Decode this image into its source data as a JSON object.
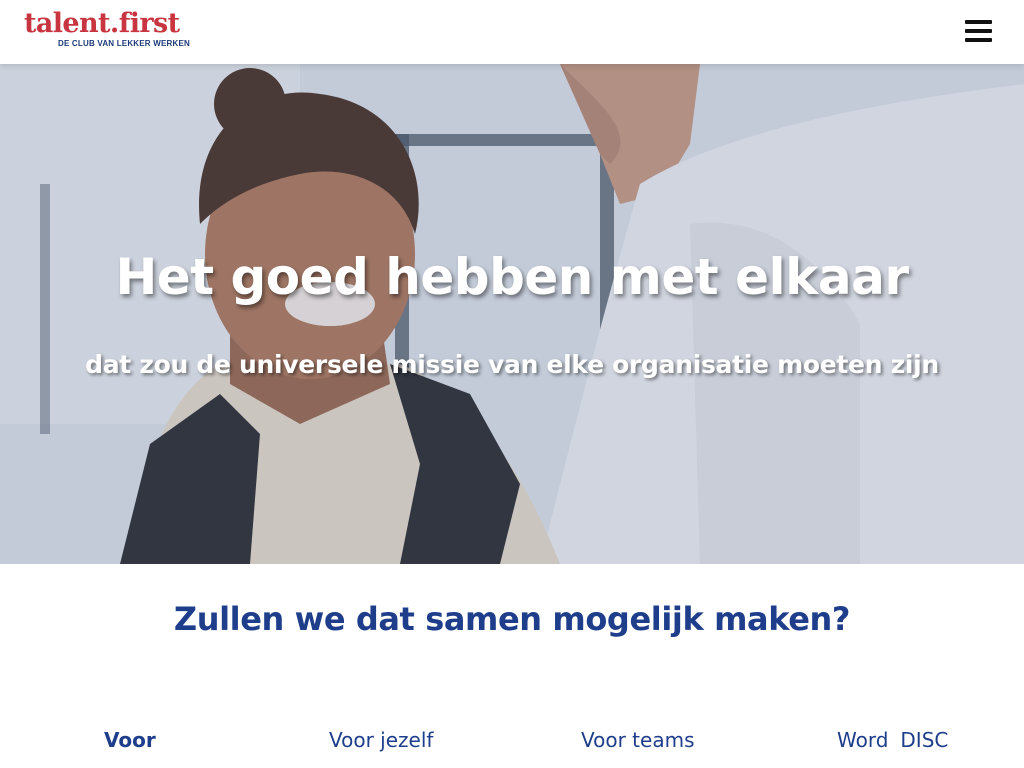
{
  "header": {
    "logo_text": "talent.first",
    "logo_tagline": "DE CLUB VAN LEKKER WERKEN",
    "menu_icon": "hamburger-menu-icon"
  },
  "hero": {
    "title": "Het goed hebben met elkaar",
    "subtitle": "dat zou de universele missie van elke organisatie moeten zijn",
    "image": "photo of a smiling woman talking with a man in an office"
  },
  "main": {
    "heading": "Zullen we dat samen mogelijk maken?",
    "tabs": [
      {
        "label": "Voor"
      },
      {
        "label": "Voor jezelf"
      },
      {
        "label": "Voor teams"
      },
      {
        "label_a": "Word",
        "label_b": "DISC"
      }
    ]
  },
  "colors": {
    "brand_red": "#c8343f",
    "brand_blue": "#1e3e8c",
    "header_bg": "#ffffff"
  }
}
